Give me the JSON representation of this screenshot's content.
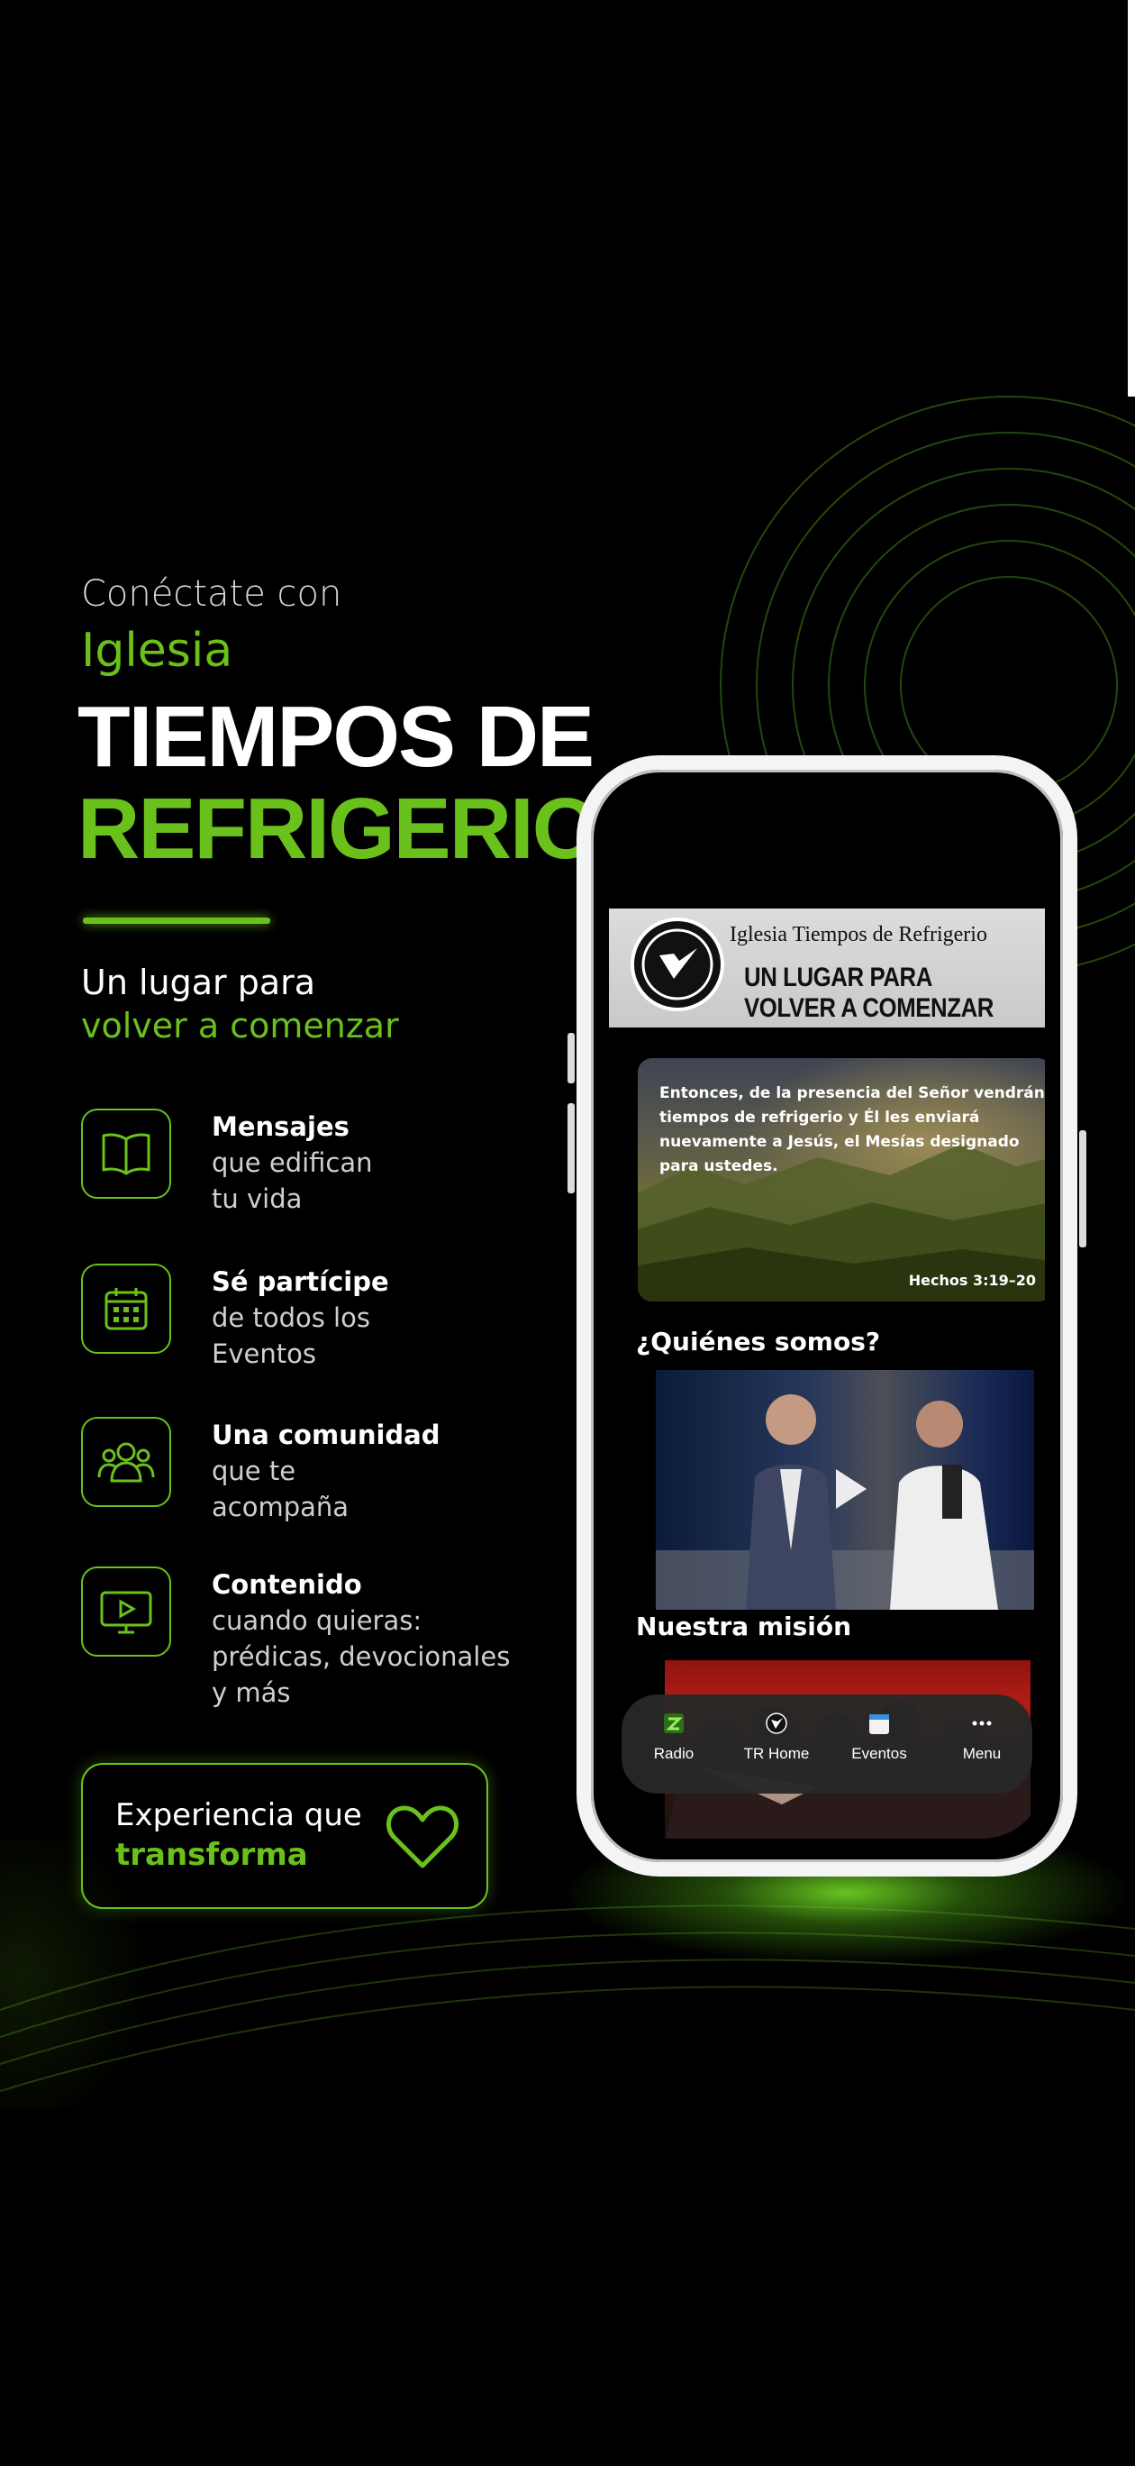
{
  "colors": {
    "accent": "#6bc11c",
    "background": "#000000",
    "text": "#ffffff"
  },
  "hero": {
    "eyebrow": "Conéctate con",
    "eyebrow_accent": "Iglesia",
    "brand_line1": "TIEMPOS DE",
    "brand_line2": "REFRIGERIO",
    "tagline_line1": "Un lugar para",
    "tagline_line2": "volver a comenzar"
  },
  "features": [
    {
      "icon": "book-icon",
      "title": "Mensajes",
      "desc": "que edifican\ntu vida"
    },
    {
      "icon": "calendar-icon",
      "title": "Sé partícipe",
      "desc": "de todos los\nEventos"
    },
    {
      "icon": "community-icon",
      "title": "Una comunidad",
      "desc": "que te\nacompaña"
    },
    {
      "icon": "video-icon",
      "title": "Contenido",
      "desc": "cuando quieras:\nprédicas, devocionales\ny más"
    }
  ],
  "cta": {
    "line1": "Experiencia que",
    "line2": "transforma",
    "icon": "heart-icon"
  },
  "phone": {
    "header": {
      "church_name": "Iglesia Tiempos de Refrigerio",
      "motto": "UN LUGAR PARA VOLVER A COMENZAR"
    },
    "verse": {
      "text": "Entonces, de la presencia del Señor vendrán tiempos de refrigerio y Él les enviará nuevamente a Jesús, el Mesías designado para ustedes.",
      "reference": "Hechos 3:19–20"
    },
    "about_title": "¿Quiénes somos?",
    "mission_title": "Nuestra misión",
    "tabs": [
      {
        "label": "Radio",
        "icon": "radio-icon"
      },
      {
        "label": "TR Home",
        "icon": "home-logo-icon"
      },
      {
        "label": "Eventos",
        "icon": "calendar-icon"
      },
      {
        "label": "Menu",
        "icon": "more-icon"
      }
    ]
  }
}
